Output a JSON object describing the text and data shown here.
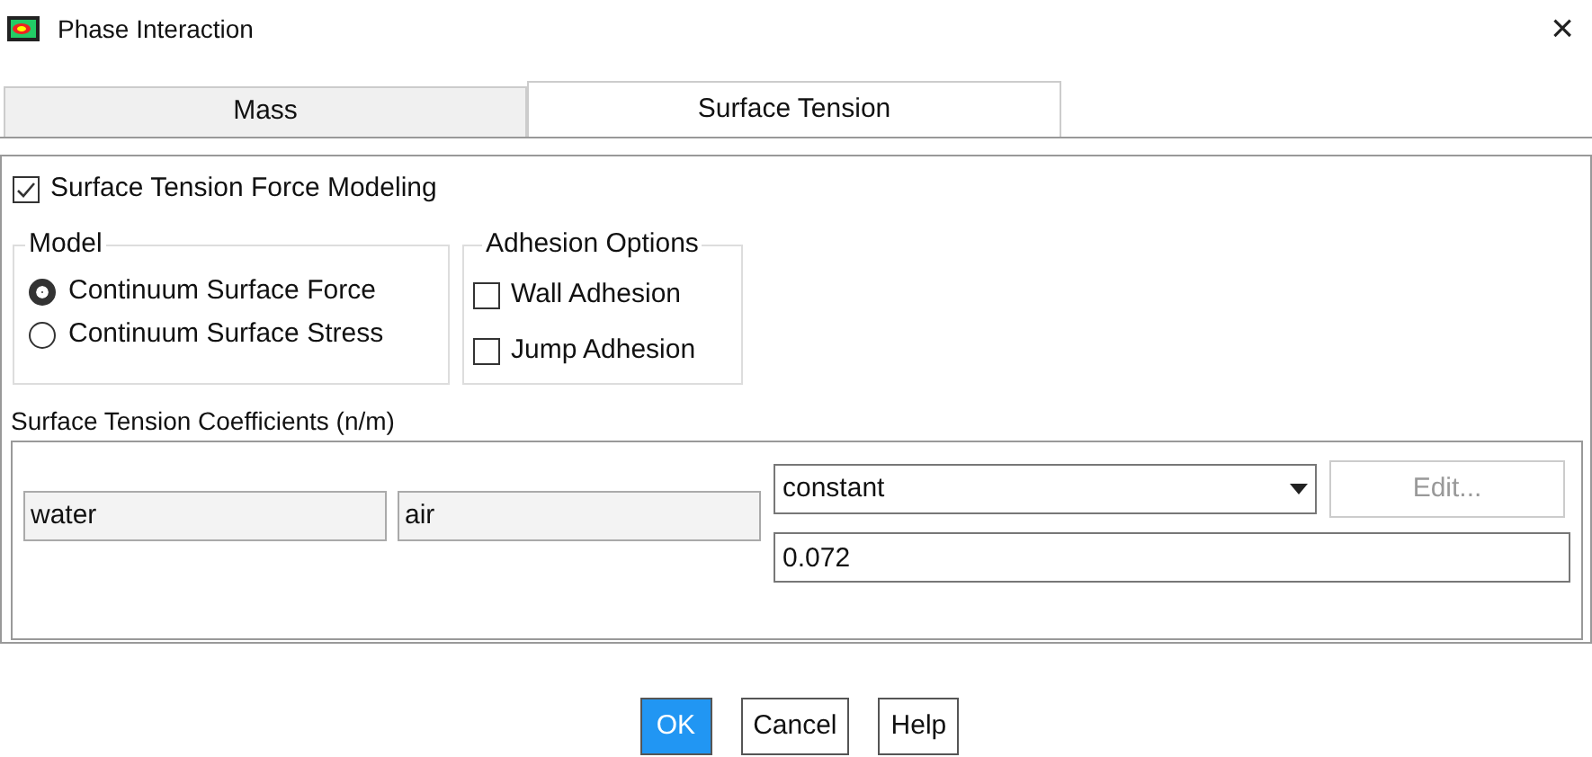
{
  "window": {
    "title": "Phase Interaction",
    "close": "×"
  },
  "tabs": [
    {
      "label": "Mass",
      "selected": false
    },
    {
      "label": "Surface Tension",
      "selected": true
    }
  ],
  "modeling": {
    "label": "Surface Tension Force Modeling",
    "checked": true
  },
  "model": {
    "title": "Model",
    "options": [
      {
        "label": "Continuum Surface Force",
        "selected": true
      },
      {
        "label": "Continuum Surface Stress",
        "selected": false
      }
    ]
  },
  "adhesion": {
    "title": "Adhesion Options",
    "options": [
      {
        "label": "Wall Adhesion",
        "checked": false
      },
      {
        "label": "Jump Adhesion",
        "checked": false
      }
    ]
  },
  "coefficients": {
    "title": "Surface Tension Coefficients (n/m)",
    "phase_1": "water",
    "phase_2": "air",
    "method": "constant",
    "edit": {
      "label": "Edit...",
      "disabled": true
    },
    "value": "0.072"
  },
  "buttons": [
    {
      "label": "OK",
      "primary": true
    },
    {
      "label": "Cancel",
      "primary": false
    },
    {
      "label": "Help",
      "primary": false
    }
  ]
}
